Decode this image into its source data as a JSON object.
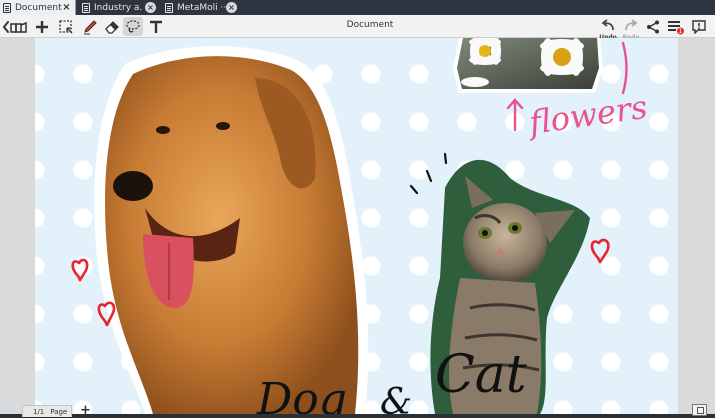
{
  "tabs": [
    {
      "label": "Document",
      "active": true
    },
    {
      "label": "Industry a.",
      "active": false
    },
    {
      "label": "MetaMoli ···",
      "active": false
    }
  ],
  "toolbar": {
    "title": "Document",
    "undo_label": "Undo",
    "redo_label": "Redo",
    "notification_count": "1"
  },
  "canvas": {
    "background": "#e3f1fb",
    "dots": "#ffffff",
    "annotations": {
      "flowers": "flowers",
      "dog": "Dog",
      "amp": "&",
      "cat": "Cat"
    },
    "stickers": [
      "dog-photo",
      "cat-photo",
      "daisy-photo"
    ],
    "heart_color": "#e8262e",
    "flowers_ink": "#e8528e"
  },
  "pager": {
    "page": "1/1",
    "label": "Page"
  }
}
